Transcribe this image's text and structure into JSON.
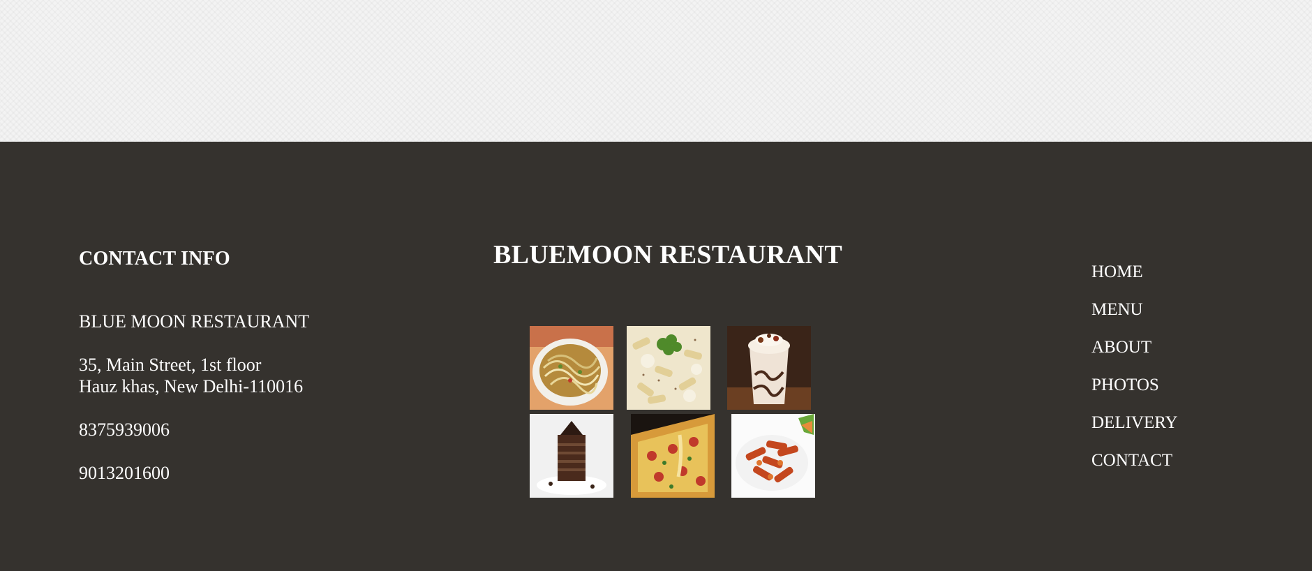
{
  "contact": {
    "heading": "CONTACT INFO",
    "name": "BLUE MOON RESTAURANT",
    "address_line1": "35, Main Street, 1st floor",
    "address_line2": "Hauz khas, New Delhi-110016",
    "phone1": "8375939006",
    "phone2": "9013201600"
  },
  "brand": {
    "title": "BLUEMOON RESTAURANT"
  },
  "gallery": [
    {
      "name": "noodles-photo"
    },
    {
      "name": "white-sauce-pasta-photo"
    },
    {
      "name": "milkshake-photo"
    },
    {
      "name": "chocolate-cake-photo"
    },
    {
      "name": "pizza-photo"
    },
    {
      "name": "red-sauce-pasta-photo"
    }
  ],
  "nav": {
    "items": [
      {
        "label": "HOME"
      },
      {
        "label": "MENU"
      },
      {
        "label": "ABOUT"
      },
      {
        "label": "PHOTOS"
      },
      {
        "label": "DELIVERY"
      },
      {
        "label": "CONTACT"
      }
    ]
  },
  "colors": {
    "footer_bg": "#35322e",
    "top_bg": "#f3f3f3",
    "text": "#ffffff"
  }
}
